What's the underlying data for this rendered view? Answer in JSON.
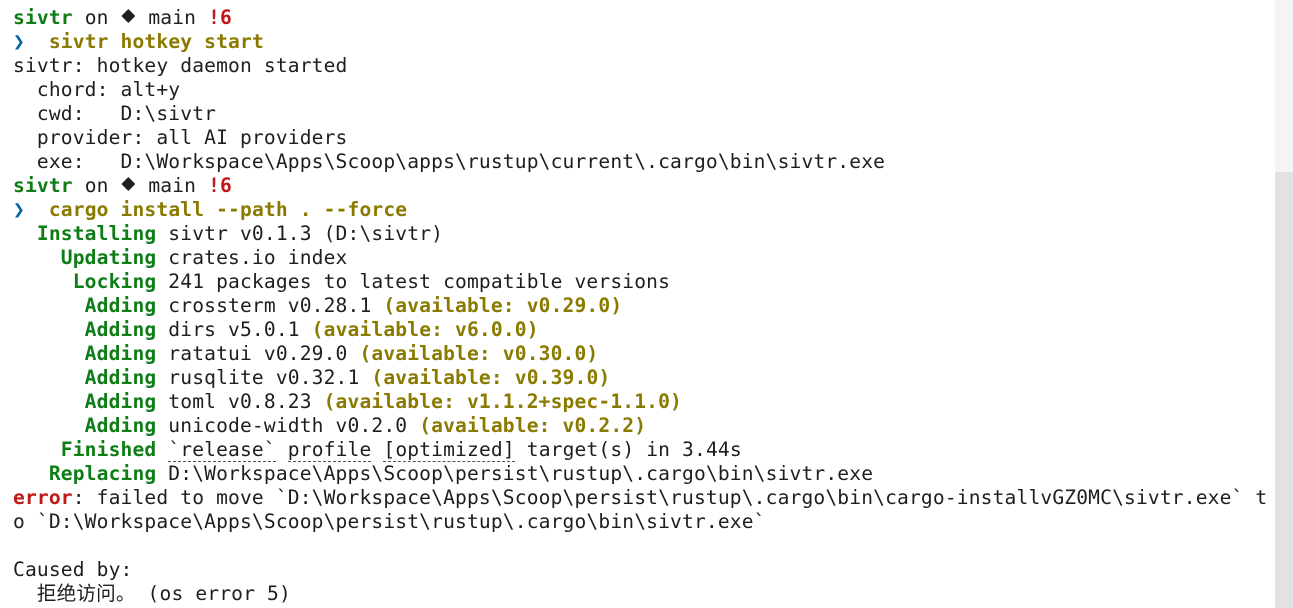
{
  "colors": {
    "background": "#ffffff",
    "text": "#1e1e1e",
    "cargo_status_green": "#0f7d15",
    "available_olive": "#8a7a00",
    "prompt_arrow_blue": "#0066a8",
    "error_red": "#c01818"
  },
  "icons": {
    "git_branch": "git-branch-icon",
    "prompt": "prompt-chevron-icon"
  },
  "prompt1": {
    "dir": "sivtr",
    "on": "on",
    "branch_glyph": "⯁",
    "branch": "main",
    "status": "!6",
    "arrow": "❯",
    "command": "sivtr hotkey start"
  },
  "hotkey_output": {
    "line1": "sivtr: hotkey daemon started",
    "chord": "  chord: alt+y",
    "cwd": "  cwd:   D:\\sivtr",
    "provider": "  provider: all AI providers",
    "exe": "  exe:   D:\\Workspace\\Apps\\Scoop\\apps\\rustup\\current\\.cargo\\bin\\sivtr.exe"
  },
  "prompt2": {
    "dir": "sivtr",
    "on": "on",
    "branch_glyph": "⯁",
    "branch": "main",
    "status": "!6",
    "arrow": "❯",
    "command": "cargo install --path . --force"
  },
  "cargo_output": {
    "installing": {
      "label": "  Installing",
      "text": " sivtr v0.1.3 (D:\\sivtr)"
    },
    "updating": {
      "label": "    Updating",
      "text": " crates.io index"
    },
    "locking": {
      "label": "     Locking",
      "text": " 241 packages to latest compatible versions"
    },
    "adding": [
      {
        "label": "      Adding",
        "text": " crossterm v0.28.1 ",
        "avail": "(available: v0.29.0)"
      },
      {
        "label": "      Adding",
        "text": " dirs v5.0.1 ",
        "avail": "(available: v6.0.0)"
      },
      {
        "label": "      Adding",
        "text": " ratatui v0.29.0 ",
        "avail": "(available: v0.30.0)"
      },
      {
        "label": "      Adding",
        "text": " rusqlite v0.32.1 ",
        "avail": "(available: v0.39.0)"
      },
      {
        "label": "      Adding",
        "text": " toml v0.8.23 ",
        "avail": "(available: v1.1.2+spec-1.1.0)"
      },
      {
        "label": "      Adding",
        "text": " unicode-width v0.2.0 ",
        "avail": "(available: v0.2.2)"
      }
    ],
    "finished": {
      "label": "    Finished",
      "pre": " ",
      "release": "`release`",
      "mid": " ",
      "profile": "profile",
      "mid2": " ",
      "optimized": "[optimized]",
      "rest": " target(s) in 3.44s"
    },
    "replacing": {
      "label": "   Replacing",
      "text": " D:\\Workspace\\Apps\\Scoop\\persist\\rustup\\.cargo\\bin\\sivtr.exe"
    }
  },
  "error": {
    "label": "error",
    "line1": ": failed to move `D:\\Workspace\\Apps\\Scoop\\persist\\rustup\\.cargo\\bin\\cargo-installvGZ0MC\\sivtr.exe` t",
    "line2": "o `D:\\Workspace\\Apps\\Scoop\\persist\\rustup\\.cargo\\bin\\sivtr.exe`",
    "caused_by": "Caused by:",
    "cause": "  拒绝访问。 (os error 5)"
  }
}
